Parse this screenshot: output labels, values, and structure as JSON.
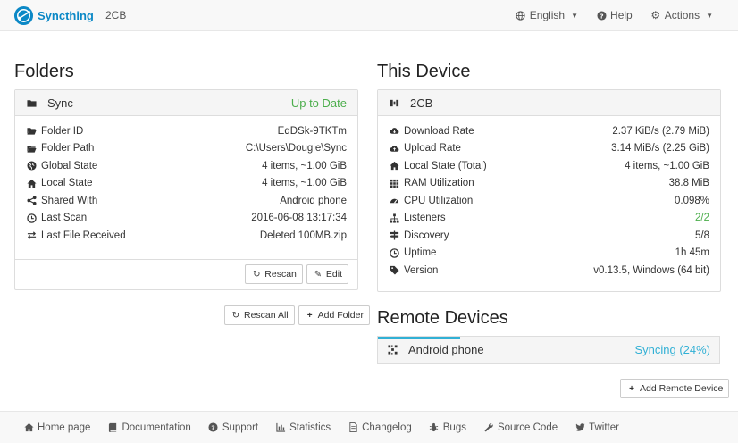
{
  "nav": {
    "brand": "Syncthing",
    "device_name": "2CB",
    "language": "English",
    "help": "Help",
    "actions": "Actions"
  },
  "folders": {
    "heading": "Folders",
    "folder": {
      "name": "Sync",
      "status": "Up to Date",
      "rows": [
        {
          "label": "Folder ID",
          "value": "EqDSk-9TKTm"
        },
        {
          "label": "Folder Path",
          "value": "C:\\Users\\Dougie\\Sync"
        },
        {
          "label": "Global State",
          "value": "4 items, ~1.00 GiB"
        },
        {
          "label": "Local State",
          "value": "4 items, ~1.00 GiB"
        },
        {
          "label": "Shared With",
          "value": "Android phone"
        },
        {
          "label": "Last Scan",
          "value": "2016-06-08 13:17:34"
        },
        {
          "label": "Last File Received",
          "value": "Deleted 100MB.zip"
        }
      ],
      "rescan": "Rescan",
      "edit": "Edit"
    },
    "rescan_all": "Rescan All",
    "add_folder": "Add Folder"
  },
  "this_device": {
    "heading": "This Device",
    "name": "2CB",
    "rows": [
      {
        "label": "Download Rate",
        "value": "2.37 KiB/s (2.79 MiB)"
      },
      {
        "label": "Upload Rate",
        "value": "3.14 MiB/s (2.25 GiB)"
      },
      {
        "label": "Local State (Total)",
        "value": "4 items, ~1.00 GiB"
      },
      {
        "label": "RAM Utilization",
        "value": "38.8 MiB"
      },
      {
        "label": "CPU Utilization",
        "value": "0.098%"
      },
      {
        "label": "Listeners",
        "value": "2/2"
      },
      {
        "label": "Discovery",
        "value": "5/8"
      },
      {
        "label": "Uptime",
        "value": "1h 45m"
      },
      {
        "label": "Version",
        "value": "v0.13.5, Windows (64 bit)"
      }
    ]
  },
  "remote": {
    "heading": "Remote Devices",
    "device": "Android phone",
    "status": "Syncing (24%)",
    "progress": 0.24,
    "add": "Add Remote Device"
  },
  "footer": {
    "links": [
      "Home page",
      "Documentation",
      "Support",
      "Statistics",
      "Changelog",
      "Bugs",
      "Source Code",
      "Twitter"
    ]
  },
  "colors": {
    "brand": "#0b88c6",
    "success": "#4cae4c",
    "info": "#31b0d5"
  }
}
